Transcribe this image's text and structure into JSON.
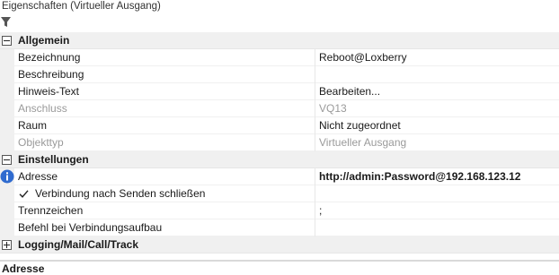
{
  "panel": {
    "title": "Eigenschaften (Virtueller Ausgang)"
  },
  "toolbar": {
    "filter_icon": "filter-icon"
  },
  "categories": {
    "general": "Allgemein",
    "settings": "Einstellungen",
    "logging": "Logging/Mail/Call/Track"
  },
  "general_rows": [
    {
      "name": "Bezeichnung",
      "value": "Reboot@Loxberry"
    },
    {
      "name": "Beschreibung",
      "value": ""
    },
    {
      "name": "Hinweis-Text",
      "value": "Bearbeiten..."
    },
    {
      "name": "Anschluss",
      "value": "VQ13"
    },
    {
      "name": "Raum",
      "value": "Nicht zugeordnet"
    },
    {
      "name": "Objekttyp",
      "value": "Virtueller Ausgang"
    }
  ],
  "settings_rows": [
    {
      "name": "Adresse",
      "value": "http://admin:Password@192.168.123.12"
    },
    {
      "name": "Verbindung nach Senden schließen",
      "checked": true
    },
    {
      "name": "Trennzeichen",
      "value": ";"
    },
    {
      "name": "Befehl bei Verbindungsaufbau",
      "value": ""
    }
  ],
  "description": {
    "title": "Adresse"
  },
  "colors": {
    "info_blue": "#2f6bcf",
    "category_bg": "#f0f0f0",
    "disabled_text": "#9a9a9a"
  }
}
